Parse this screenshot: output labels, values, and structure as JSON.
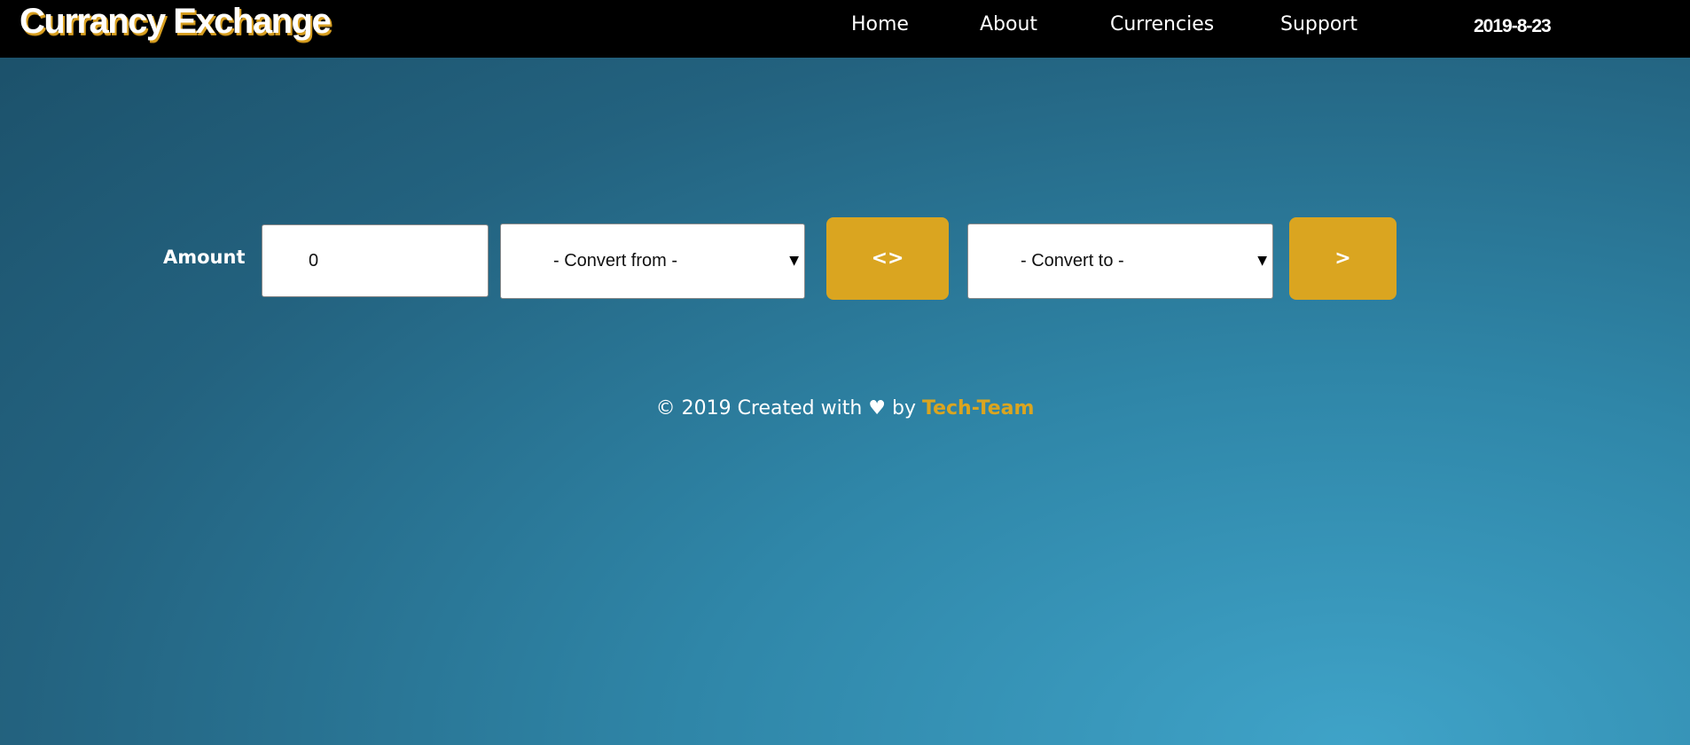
{
  "header": {
    "brand": "Currancy Exchange",
    "nav": [
      {
        "label": "Home"
      },
      {
        "label": "About"
      },
      {
        "label": "Currencies"
      },
      {
        "label": "Support"
      }
    ],
    "date": "2019-8-23"
  },
  "converter": {
    "amount_label": "Amount",
    "amount_value": "0",
    "convert_from": "- Convert from -",
    "swap_label": "<>",
    "convert_to": "- Convert to -",
    "go_label": ">"
  },
  "footer": {
    "text_before": "© 2019 Created with ♥ by ",
    "team": "Tech-Team"
  },
  "colors": {
    "accent": "#daa520",
    "nav_background": "#000000",
    "page_background": "#2f86a8"
  }
}
